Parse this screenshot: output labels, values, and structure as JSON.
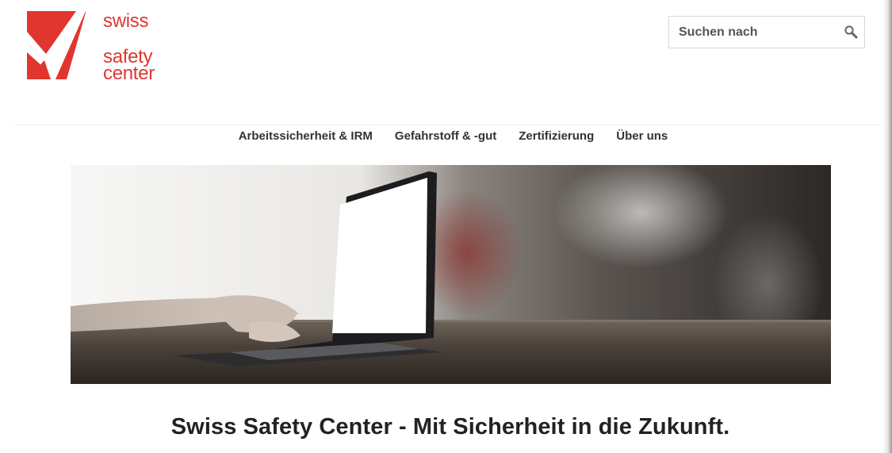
{
  "logo": {
    "line1": "swiss",
    "line2": "safety",
    "line3": "center",
    "brand_color": "#e1362f"
  },
  "search": {
    "placeholder": "Suchen nach",
    "icon": "search-icon"
  },
  "nav": {
    "items": [
      {
        "label": "Arbeitssicherheit & IRM"
      },
      {
        "label": "Gefahrstoff & -gut"
      },
      {
        "label": "Zertifizierung"
      },
      {
        "label": "Über uns"
      }
    ]
  },
  "hero": {
    "image": "hero-image"
  },
  "headline": "Swiss Safety Center - Mit Sicherheit in die Zukunft."
}
